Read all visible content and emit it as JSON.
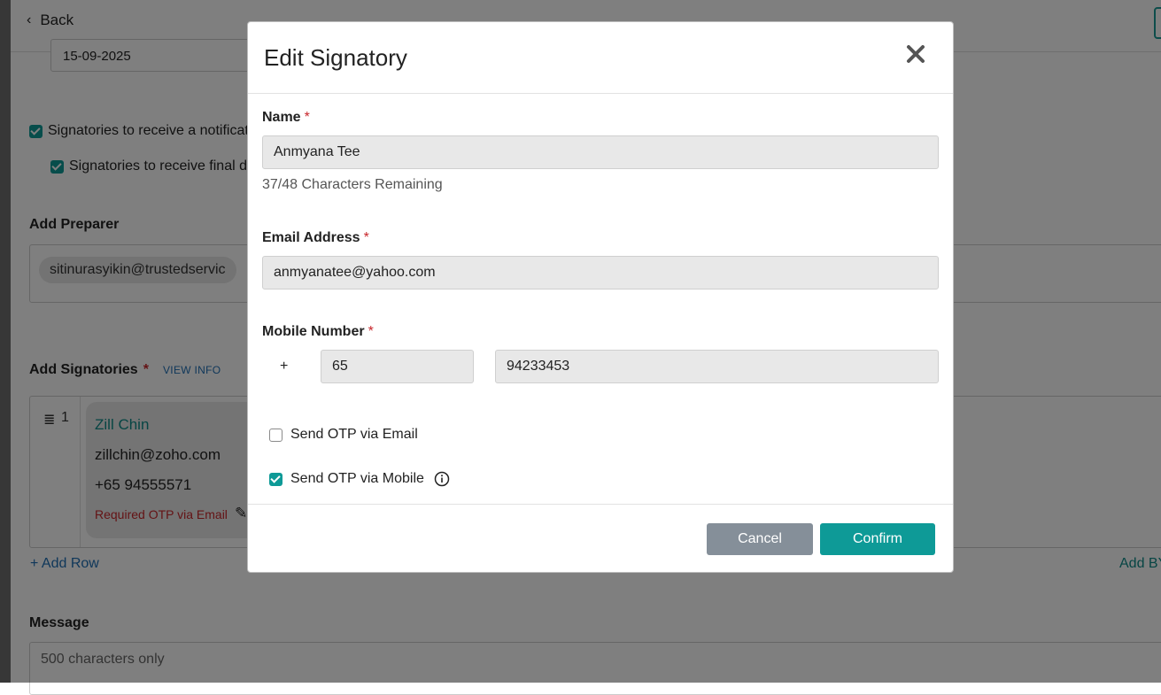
{
  "background": {
    "back_label": "Back",
    "date_value": "15-09-2025",
    "notify_sign_request_label": "Signatories to receive a notificat",
    "notify_final_doc_label": "Signatories to receive final d",
    "add_preparer_title": "Add Preparer",
    "preparer_email": "sitinurasyikin@trustedservic",
    "add_signatories_title": "Add Signatories",
    "required_mark": "*",
    "view_info_label": "VIEW INFO",
    "signatory": {
      "order": "1",
      "name": "Zill Chin",
      "email": "zillchin@zoho.com",
      "phone": "+65 94555571",
      "otp_note": "Required OTP via Email"
    },
    "add_row_label": "+ Add Row",
    "add_by_label": "Add BY",
    "message_title": "Message",
    "message_placeholder": "500 characters only"
  },
  "modal": {
    "title": "Edit Signatory",
    "name_label": "Name",
    "name_value": "Anmyana Tee",
    "name_helper": "37/48 Characters Remaining",
    "email_label": "Email Address",
    "email_value": "anmyanatee@yahoo.com",
    "mobile_label": "Mobile Number",
    "country_prefix": "+",
    "country_code": "65",
    "mobile_value": "94233453",
    "required_mark": "*",
    "otp_email_label": "Send OTP via Email",
    "otp_email_checked": false,
    "otp_mobile_label": "Send OTP via Mobile",
    "otp_mobile_checked": true,
    "cancel_label": "Cancel",
    "confirm_label": "Confirm"
  },
  "colors": {
    "accent": "#0e9a97",
    "required": "#c8262b",
    "link": "#1f6fb5",
    "cancel": "#858f99"
  },
  "icons": [
    "chevron-left-icon",
    "close-icon",
    "info-icon",
    "drag-handle-icon",
    "pencil-icon",
    "checkbox-icon"
  ]
}
